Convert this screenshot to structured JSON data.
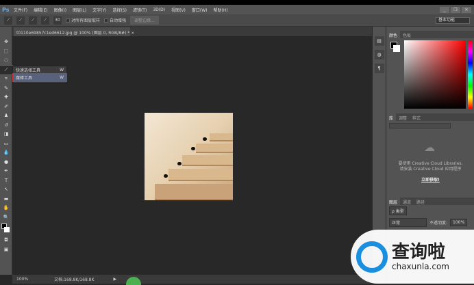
{
  "app": {
    "logo": "Ps"
  },
  "menu": [
    "文件(F)",
    "编辑(E)",
    "图像(I)",
    "图层(L)",
    "文字(Y)",
    "选择(S)",
    "滤镜(T)",
    "3D(D)",
    "视图(V)",
    "窗口(W)",
    "帮助(H)"
  ],
  "window_controls": {
    "minimize": "_",
    "restore": "❐",
    "close": "✕"
  },
  "options": {
    "brush_size": "30",
    "sample_all_layers": "对所有图层取样",
    "auto_enhance": "自动增强",
    "refine_edge": "调整边缘...",
    "workspace": "基本功能"
  },
  "document_tab": {
    "title": "t0110e69857c1ed6612.jpg @ 100% (图层 0, RGB/8#) *",
    "close": "×"
  },
  "flyout": [
    {
      "label": "快速选择工具",
      "key": "W"
    },
    {
      "label": "魔棒工具",
      "key": "W"
    }
  ],
  "status": {
    "zoom": "100%",
    "doc": "文档:168.8K/168.8K",
    "arrow": "▶"
  },
  "color_panel": {
    "tabs": [
      "颜色",
      "色板"
    ]
  },
  "libraries_panel": {
    "tabs": [
      "库",
      "调整",
      "样式"
    ],
    "message1": "要使用 Creative Cloud Libraries,",
    "message2": "请安装 Creative Cloud 应用程序",
    "join": "立即获取!"
  },
  "layers_panel": {
    "tabs": [
      "图层",
      "通道",
      "路径"
    ],
    "filter": "ρ 类型",
    "blend": "正常",
    "opacity_label": "不透明度:",
    "opacity": "100%"
  },
  "watermark": {
    "brand": "查询啦",
    "url": "chaxunla.com"
  }
}
